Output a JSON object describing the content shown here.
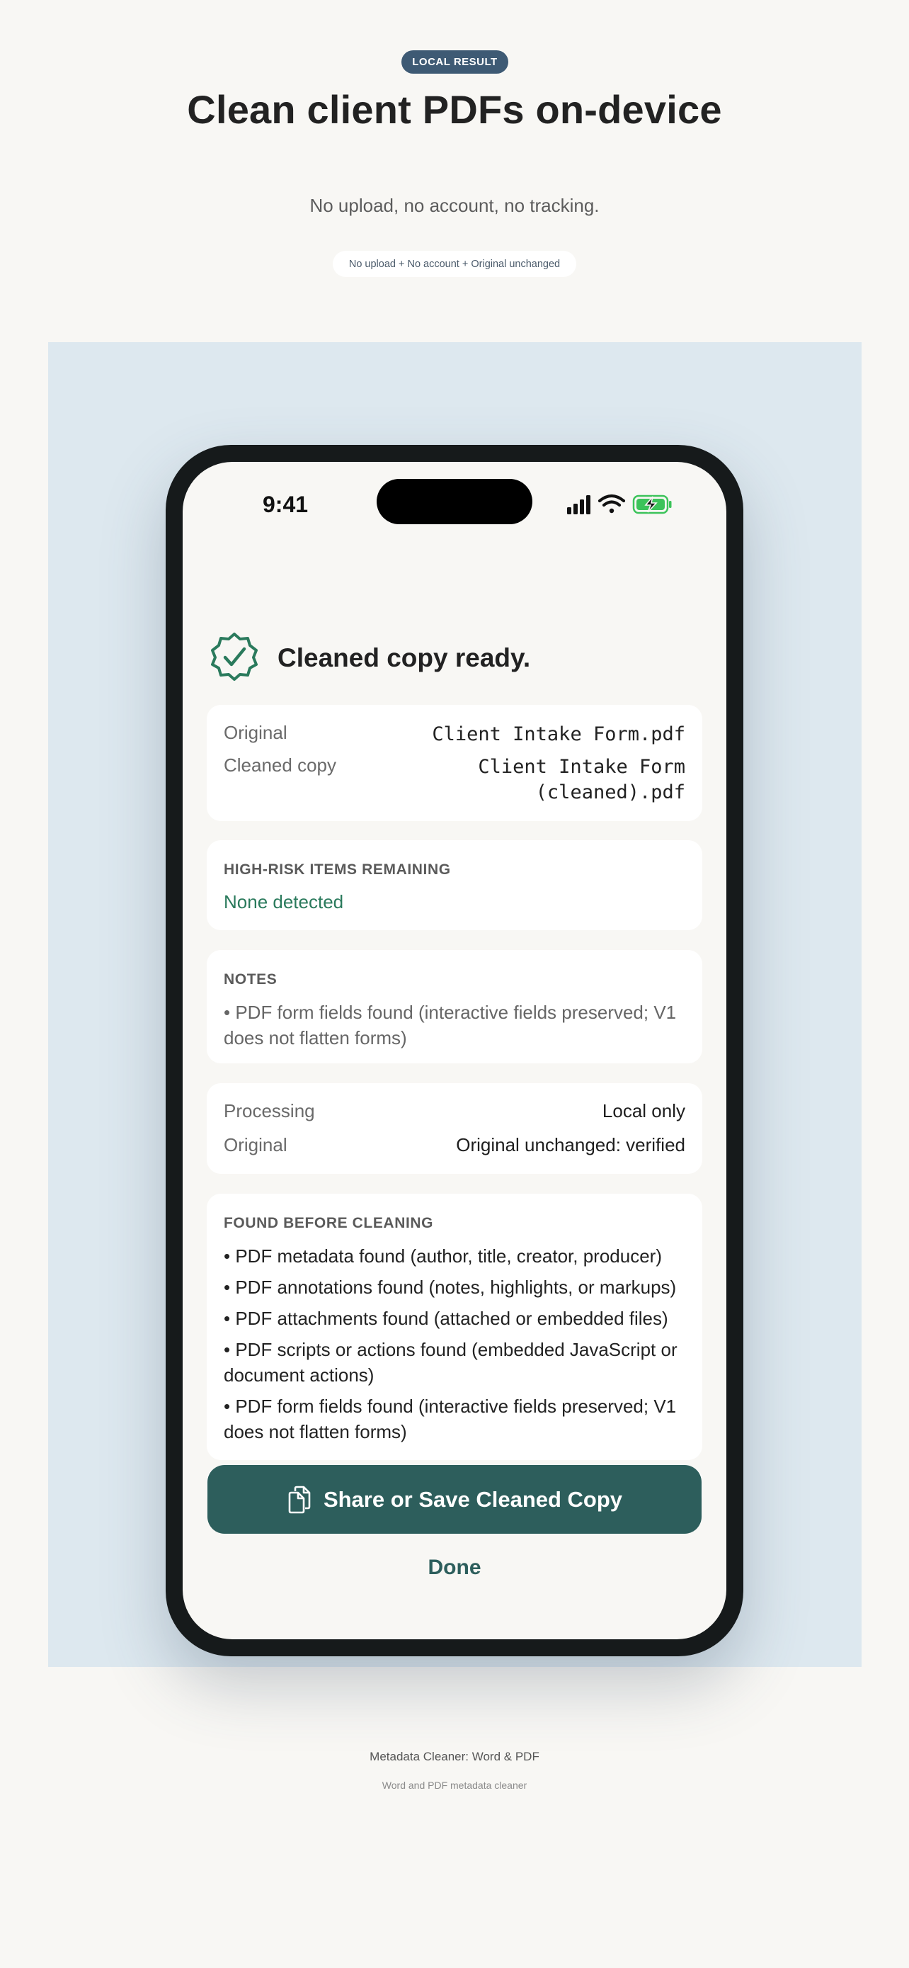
{
  "hero": {
    "badge": "LOCAL RESULT",
    "headline": "Clean client PDFs on-device",
    "subhead": "No upload, no account, no tracking.",
    "pill": "No upload + No account + Original unchanged"
  },
  "phone": {
    "status_bar": {
      "time": "9:41",
      "icons": [
        "cellular-signal-icon",
        "wifi-icon",
        "battery-charging-icon"
      ],
      "battery_color": "#3cc35a"
    },
    "result": {
      "title": "Cleaned copy ready.",
      "icon": "verified-seal-icon",
      "accent": "#2a7a5c"
    },
    "files": {
      "original_label": "Original",
      "original_value": "Client Intake Form.pdf",
      "cleaned_label": "Cleaned copy",
      "cleaned_value_line1": "Client Intake Form",
      "cleaned_value_line2": "(cleaned).pdf"
    },
    "high_risk": {
      "label": "HIGH-RISK ITEMS REMAINING",
      "value": "None detected"
    },
    "notes": {
      "label": "NOTES",
      "items": [
        "• PDF form fields found (interactive fields preserved; V1 does not flatten forms)"
      ]
    },
    "processing": {
      "processing_label": "Processing",
      "processing_value": "Local only",
      "original_label": "Original",
      "original_value": "Original unchanged: verified"
    },
    "found": {
      "label": "FOUND BEFORE CLEANING",
      "items": [
        "• PDF metadata found (author, title, creator, producer)",
        "• PDF annotations found (notes, highlights, or markups)",
        "• PDF attachments found (attached or embedded files)",
        "• PDF scripts or actions found (embedded JavaScript or document actions)",
        "• PDF form fields found (interactive fields preserved; V1 does not flatten forms)"
      ]
    },
    "actions": {
      "share_label": "Share or Save Cleaned Copy",
      "share_icon": "documents-icon",
      "done_label": "Done",
      "button_color": "#2d5e5c"
    }
  },
  "footer": {
    "app_name": "Metadata Cleaner: Word & PDF",
    "tagline": "Word and PDF metadata cleaner"
  }
}
